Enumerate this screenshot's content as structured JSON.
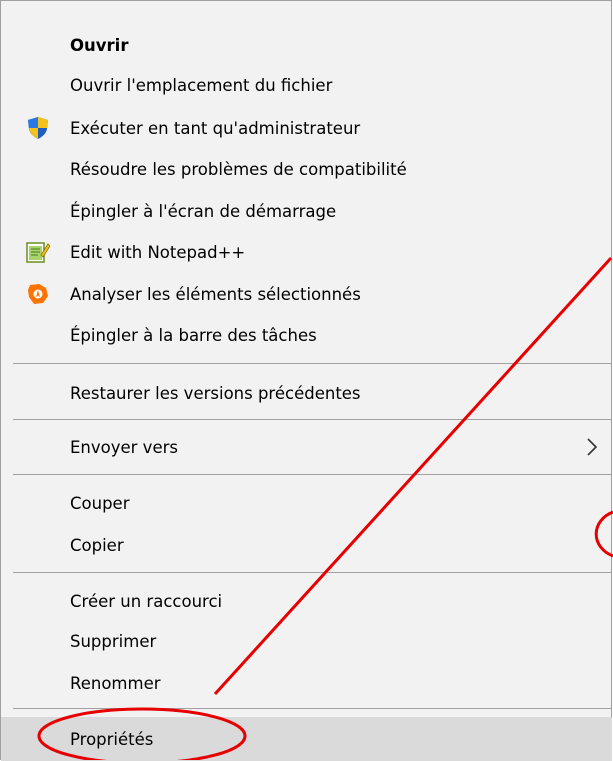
{
  "menu": {
    "items": [
      {
        "label": "Ouvrir"
      },
      {
        "label": "Ouvrir l'emplacement du fichier"
      },
      {
        "label": "Exécuter en tant qu'administrateur",
        "icon": "uac-shield-icon"
      },
      {
        "label": "Résoudre les problèmes de compatibilité"
      },
      {
        "label": "Épingler à l'écran de démarrage"
      },
      {
        "label": "Edit with Notepad++",
        "icon": "notepad-plus-plus-icon"
      },
      {
        "label": "Analyser les éléments sélectionnés",
        "icon": "avast-icon"
      },
      {
        "label": "Épingler à la barre des tâches"
      },
      {
        "label": "Restaurer les versions précédentes"
      },
      {
        "label": "Envoyer vers",
        "icon": "chevron-right-icon"
      },
      {
        "label": "Couper"
      },
      {
        "label": "Copier"
      },
      {
        "label": "Créer un raccourci"
      },
      {
        "label": "Supprimer"
      },
      {
        "label": "Renommer"
      },
      {
        "label": "Propriétés",
        "state": "highlighted"
      }
    ]
  },
  "annotation": {
    "color": "#e60000",
    "shapes": [
      "circle-around-properties",
      "arrow-line",
      "partial-circle-right-edge"
    ]
  },
  "colors": {
    "menu_bg": "#f2f2f2",
    "hover_bg": "#dadada",
    "separator": "#a0a0a0",
    "annotation": "#e60000"
  }
}
